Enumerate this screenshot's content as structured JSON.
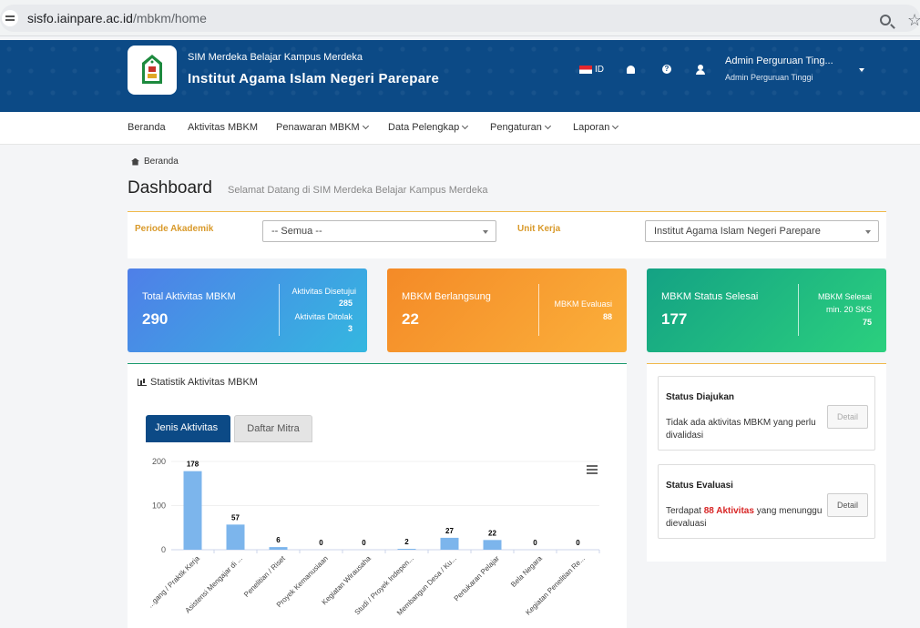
{
  "browser": {
    "url_host": "sisfo.iainpare.ac.id",
    "url_path": "/mbkm/home"
  },
  "header": {
    "subtitle": "SIM Merdeka Belajar Kampus Merdeka",
    "title": "Institut Agama Islam Negeri Parepare",
    "lang": "ID",
    "user_name": "Admin Perguruan Ting...",
    "user_role": "Admin Perguruan Tinggi"
  },
  "nav": {
    "items": [
      {
        "label": "Beranda"
      },
      {
        "label": "Aktivitas MBKM"
      },
      {
        "label": "Penawaran MBKM"
      },
      {
        "label": "Data Pelengkap"
      },
      {
        "label": "Pengaturan"
      },
      {
        "label": "Laporan"
      }
    ]
  },
  "breadcrumb": "Beranda",
  "page": {
    "title": "Dashboard",
    "subtitle": "Selamat Datang di SIM Merdeka Belajar Kampus Merdeka"
  },
  "filters": {
    "periode_label": "Periode Akademik",
    "periode_value": "-- Semua --",
    "unit_label": "Unit Kerja",
    "unit_value": "Institut Agama Islam Negeri Parepare"
  },
  "cards": {
    "total": {
      "label": "Total Aktivitas MBKM",
      "value": "290",
      "side1_label": "Aktivitas Disetujui",
      "side1_value": "285",
      "side2_label": "Aktivitas Ditolak",
      "side2_value": "3"
    },
    "ongoing": {
      "label": "MBKM Berlangsung",
      "value": "22",
      "side_label": "MBKM Evaluasi",
      "side_value": "88"
    },
    "done": {
      "label": "MBKM Status Selesai",
      "value": "177",
      "side_label1": "MBKM Selesai",
      "side_label2": "min. 20 SKS",
      "side_value": "75"
    }
  },
  "chart_panel": {
    "title": "Statistik Aktivitas MBKM",
    "tab_active": "Jenis Aktivitas",
    "tab_inactive": "Daftar Mitra"
  },
  "chart_data": {
    "type": "bar",
    "categories": [
      "...gang / Praktik Kerja",
      "Asistensi Mengajar di ...",
      "Penelitian / Riset",
      "Proyek Kemanusiaan",
      "Kegiatan Wirausaha",
      "Studi / Proyek Indepen...",
      "Membangun Desa / Ku...",
      "Pertukaran Pelajar",
      "Bela Negara",
      "Kegiatan Penelitian Re..."
    ],
    "values": [
      178,
      57,
      6,
      0,
      0,
      2,
      27,
      22,
      0,
      0
    ],
    "y_ticks": [
      "0",
      "100",
      "200"
    ],
    "ylim": [
      0,
      200
    ],
    "bar_color": "#7cb5ec",
    "menu_icon": "hamburger-icon"
  },
  "status": {
    "submitted": {
      "title": "Status Diajukan",
      "text": "Tidak ada aktivitas MBKM yang perlu divalidasi",
      "button": "Detail"
    },
    "evaluation": {
      "title": "Status Evaluasi",
      "text_before": "Terdapat ",
      "highlight": "88 Aktivitas",
      "text_after": " yang menunggu dievaluasi",
      "button": "Detail"
    }
  }
}
